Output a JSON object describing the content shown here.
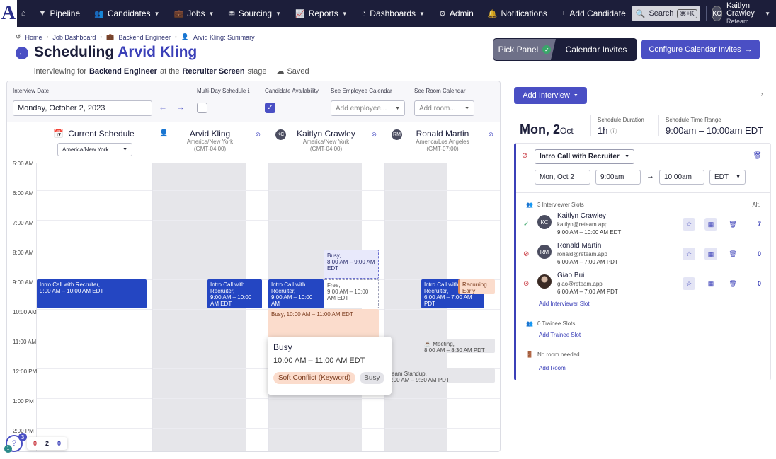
{
  "nav": {
    "logo": "A",
    "items": [
      {
        "label": "Pipeline"
      },
      {
        "label": "Candidates"
      },
      {
        "label": "Jobs"
      },
      {
        "label": "Sourcing"
      },
      {
        "label": "Reports"
      },
      {
        "label": "Dashboards"
      },
      {
        "label": "Admin"
      }
    ],
    "notifications": "Notifications",
    "add_candidate": "Add Candidate",
    "search": "Search",
    "search_kbd": "⌘+K",
    "user_initials": "KC",
    "user_name": "Kaitlyn Crawley",
    "user_org": "Reteam"
  },
  "breadcrumb": [
    "Home",
    "Job Dashboard",
    "Backend Engineer",
    "Arvid Kling: Summary"
  ],
  "header": {
    "title_prefix": "Scheduling",
    "candidate": "Arvid Kling",
    "sub_a": "interviewing for",
    "job": "Backend Engineer",
    "sub_b": "at the",
    "stage": "Recruiter Screen",
    "sub_c": "stage",
    "saved": "Saved"
  },
  "toggle": {
    "pick_panel": "Pick Panel",
    "calendar_invites": "Calendar Invites"
  },
  "configure_button": "Configure Calendar Invites",
  "filters": {
    "interview_date_label": "Interview Date",
    "interview_date": "Monday, October 2, 2023",
    "multi_day_label": "Multi-Day Schedule",
    "multi_day_info": "ℹ",
    "multi_day_checked": false,
    "availability_label": "Candidate Availability",
    "availability_checked": true,
    "employee_label": "See Employee Calendar",
    "employee_placeholder": "Add employee...",
    "room_label": "See Room Calendar",
    "room_placeholder": "Add room..."
  },
  "columns": {
    "current": {
      "title": "Current Schedule",
      "tz": "America/New York"
    },
    "people": [
      {
        "name": "Arvid Kling",
        "tz": "America/New York",
        "offset": "(GMT-04:00)"
      },
      {
        "name": "Kaitlyn Crawley",
        "initials": "KC",
        "tz": "America/New York",
        "offset": "(GMT-04:00)"
      },
      {
        "name": "Ronald Martin",
        "initials": "RM",
        "tz": "America/Los Angeles",
        "offset": "(GMT-07:00)"
      }
    ]
  },
  "time_labels": [
    "5:00 AM",
    "6:00 AM",
    "7:00 AM",
    "8:00 AM",
    "9:00 AM",
    "10:00 AM",
    "11:00 AM",
    "12:00 PM",
    "1:00 PM",
    "2:00 PM"
  ],
  "events": {
    "current_intro": {
      "title": "Intro Call with Recruiter,",
      "time": "9:00 AM – 10:00 AM EDT"
    },
    "arvid_intro": {
      "title": "Intro Call with Recruiter,",
      "time": "9:00 AM – 10:00 AM EDT"
    },
    "kc_intro": {
      "title": "Intro Call with Recruiter,",
      "time": "9:00 AM – 10:00 AM"
    },
    "kc_busy_block": {
      "title": "Busy,",
      "time": "8:00 AM – 9:00 AM EDT"
    },
    "kc_free": {
      "title": "Free,",
      "time": "9:00 AM – 10:00 AM EDT"
    },
    "kc_busy_peach": {
      "text": "Busy, 10:00 AM – 11:00 AM EDT"
    },
    "rm_intro": {
      "title": "Intro Call with Recruiter,",
      "time": "6:00 AM – 7:00 AM PDT"
    },
    "rm_recurring": {
      "text": "Recurring Early Event,"
    },
    "rm_meeting": {
      "text": "Meeting,",
      "time": "8:00 AM – 8:30 AM PDT"
    },
    "standup": {
      "text": "Team Standup,",
      "time": "9:00 AM – 9:30 AM PDT"
    }
  },
  "popover": {
    "title": "Busy",
    "time": "10:00 AM – 11:00 AM EDT",
    "warning": "Soft Conflict (Keyword)",
    "status": "Busy"
  },
  "counter": {
    "help": "?",
    "badge_top": "3",
    "badge_bottom": "1",
    "red": "0",
    "black": "2",
    "blue": "0"
  },
  "right": {
    "add_interview": "Add Interview",
    "day": "Mon,",
    "date_num": "2",
    "date_month": "Oct",
    "duration_label": "Schedule Duration",
    "duration": "1h",
    "range_label": "Schedule Time Range",
    "range": "9:00am – 10:00am EDT",
    "interview_type": "Intro Call with Recruiter",
    "date_field": "Mon, Oct 2",
    "start": "9:00am",
    "end": "10:00am",
    "tz": "EDT",
    "interviewer_slots": "3 Interviewer Slots",
    "alt_label": "Alt.",
    "interviewers": [
      {
        "initials": "KC",
        "name": "Kaitlyn Crawley",
        "email": "kaitlyn@reteam.app",
        "time": "9:00 AM – 10:00 AM EDT",
        "alt": "7",
        "status": "ok"
      },
      {
        "initials": "RM",
        "name": "Ronald Martin",
        "email": "ronald@reteam.app",
        "time": "6:00 AM – 7:00 AM PDT",
        "alt": "0",
        "status": "blocked"
      },
      {
        "initials": "",
        "name": "Giao Bui",
        "email": "giao@reteam.app",
        "time": "6:00 AM – 7:00 AM PDT",
        "alt": "0",
        "status": "blocked"
      }
    ],
    "add_interviewer": "Add Interviewer Slot",
    "trainee_slots": "0 Trainee Slots",
    "add_trainee": "Add Trainee Slot",
    "no_room": "No room needed",
    "add_room": "Add Room"
  }
}
